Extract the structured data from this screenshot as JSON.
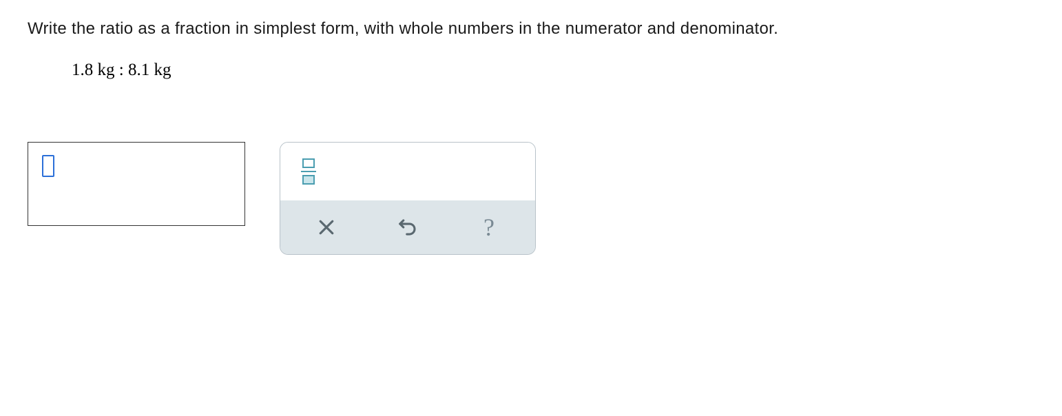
{
  "question": {
    "prompt": "Write the ratio as a fraction in simplest form, with whole numbers in the numerator and denominator.",
    "ratio": "1.8 kg : 8.1 kg"
  },
  "toolbox": {
    "fraction_tool": "fraction",
    "clear_tool": "clear",
    "undo_tool": "undo",
    "help_tool": "help",
    "help_symbol": "?"
  }
}
